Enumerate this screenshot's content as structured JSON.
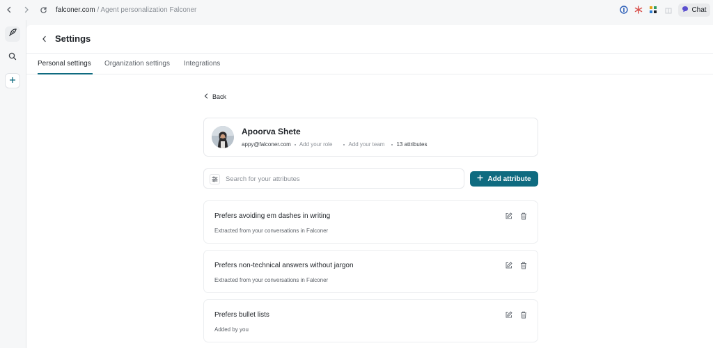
{
  "browser": {
    "url_domain": "falconer.com",
    "url_separator": " / ",
    "url_path": "Agent personalization Falconer",
    "chat_label": "Chat"
  },
  "header": {
    "title": "Settings"
  },
  "tabs": [
    {
      "label": "Personal settings",
      "active": true
    },
    {
      "label": "Organization settings",
      "active": false
    },
    {
      "label": "Integrations",
      "active": false
    }
  ],
  "back_label": "Back",
  "profile": {
    "name": "Apoorva Shete",
    "email": "appy@falconer.com",
    "role_placeholder": "Add your role",
    "team_placeholder": "Add your team",
    "attributes_count": "13 attributes"
  },
  "search": {
    "placeholder": "Search for your attributes",
    "value": ""
  },
  "add_attribute_label": "Add attribute",
  "attributes": [
    {
      "title": "Prefers avoiding em dashes in writing",
      "source": "Extracted from your conversations in Falconer"
    },
    {
      "title": "Prefers non-technical answers without jargon",
      "source": "Extracted from your conversations in Falconer"
    },
    {
      "title": "Prefers bullet lists",
      "source": "Added by you"
    }
  ],
  "colors": {
    "accent": "#0f6b80",
    "background": "#f6f7f8",
    "card_border": "#eceef0"
  }
}
